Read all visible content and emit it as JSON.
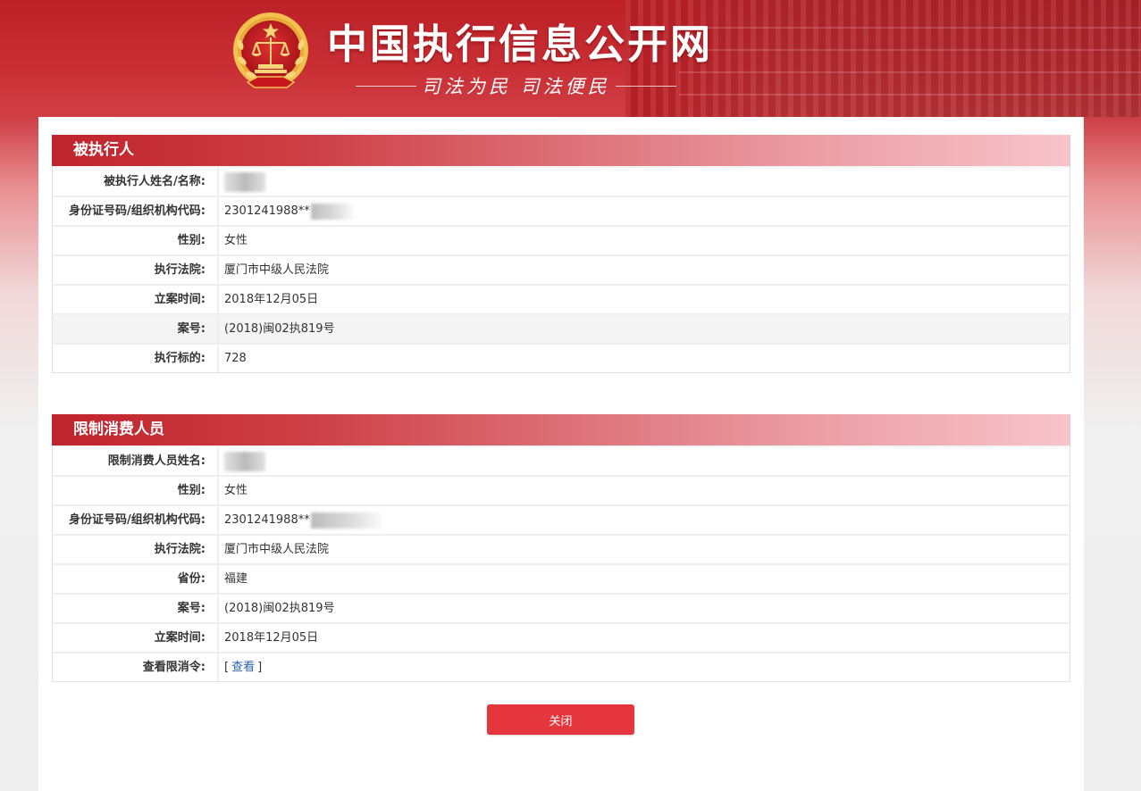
{
  "header": {
    "title": "中国执行信息公开网",
    "slogan": "司法为民  司法便民"
  },
  "executed_person": {
    "section_title": "被执行人",
    "rows": [
      {
        "label": "被执行人姓名/名称:",
        "value": ""
      },
      {
        "label": "身份证号码/组织机构代码:",
        "value": "2301241988**"
      },
      {
        "label": "性别:",
        "value": "女性"
      },
      {
        "label": "执行法院:",
        "value": "厦门市中级人民法院"
      },
      {
        "label": "立案时间:",
        "value": "2018年12月05日"
      },
      {
        "label": "案号:",
        "value": "(2018)闽02执819号"
      },
      {
        "label": "执行标的:",
        "value": "728"
      }
    ]
  },
  "restricted_consumer": {
    "section_title": "限制消费人员",
    "rows": [
      {
        "label": "限制消费人员姓名:",
        "value": ""
      },
      {
        "label": "性别:",
        "value": "女性"
      },
      {
        "label": "身份证号码/组织机构代码:",
        "value": "2301241988**"
      },
      {
        "label": "执行法院:",
        "value": "厦门市中级人民法院"
      },
      {
        "label": "省份:",
        "value": "福建"
      },
      {
        "label": "案号:",
        "value": "(2018)闽02执819号"
      },
      {
        "label": "立案时间:",
        "value": "2018年12月05日"
      },
      {
        "label": "查看限消令:",
        "value": ""
      }
    ],
    "view_link": {
      "open_bracket": "[",
      "label": "查看",
      "close_bracket": "]"
    }
  },
  "actions": {
    "close_label": "关闭"
  },
  "colors": {
    "brand_red": "#c0232b",
    "button_red": "#e5363e",
    "link_blue": "#2a63a8",
    "emblem_gold": "#f2c14e"
  }
}
